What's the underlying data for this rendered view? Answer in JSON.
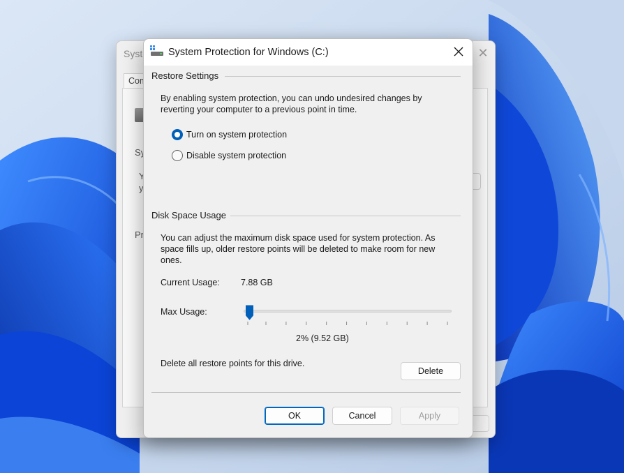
{
  "colors": {
    "accent": "#005fb8",
    "dialog_bg": "#f0f0f0",
    "wallpaper_blue": "#1e5ae6"
  },
  "background_window": {
    "title_fragment": "Syste",
    "tab_fragment": "Com",
    "fragments": [
      "Sy",
      "Y",
      "y",
      "Pr"
    ]
  },
  "dialog": {
    "title": "System Protection for Windows (C:)",
    "icons": {
      "app": "system-protection-drive-icon",
      "close": "close-icon"
    },
    "restore_settings": {
      "label": "Restore Settings",
      "description_line1": "By enabling system protection, you can undo undesired changes by",
      "description_line2": "reverting your computer to a previous point in time.",
      "options": [
        {
          "label": "Turn on system protection",
          "checked": true
        },
        {
          "label": "Disable system protection",
          "checked": false
        }
      ]
    },
    "disk_space": {
      "label": "Disk Space Usage",
      "description_line1": "You can adjust the maximum disk space used for system protection. As",
      "description_line2": "space fills up, older restore points will be deleted to make room for new",
      "description_line3": "ones.",
      "current_usage_label": "Current Usage:",
      "current_usage_value": "7.88 GB",
      "max_usage_label": "Max Usage:",
      "max_usage_percent": 2,
      "max_usage_display": "2% (9.52 GB)",
      "delete_text": "Delete all restore points for this drive.",
      "delete_button": "Delete"
    },
    "buttons": {
      "ok": "OK",
      "cancel": "Cancel",
      "apply": "Apply"
    }
  }
}
